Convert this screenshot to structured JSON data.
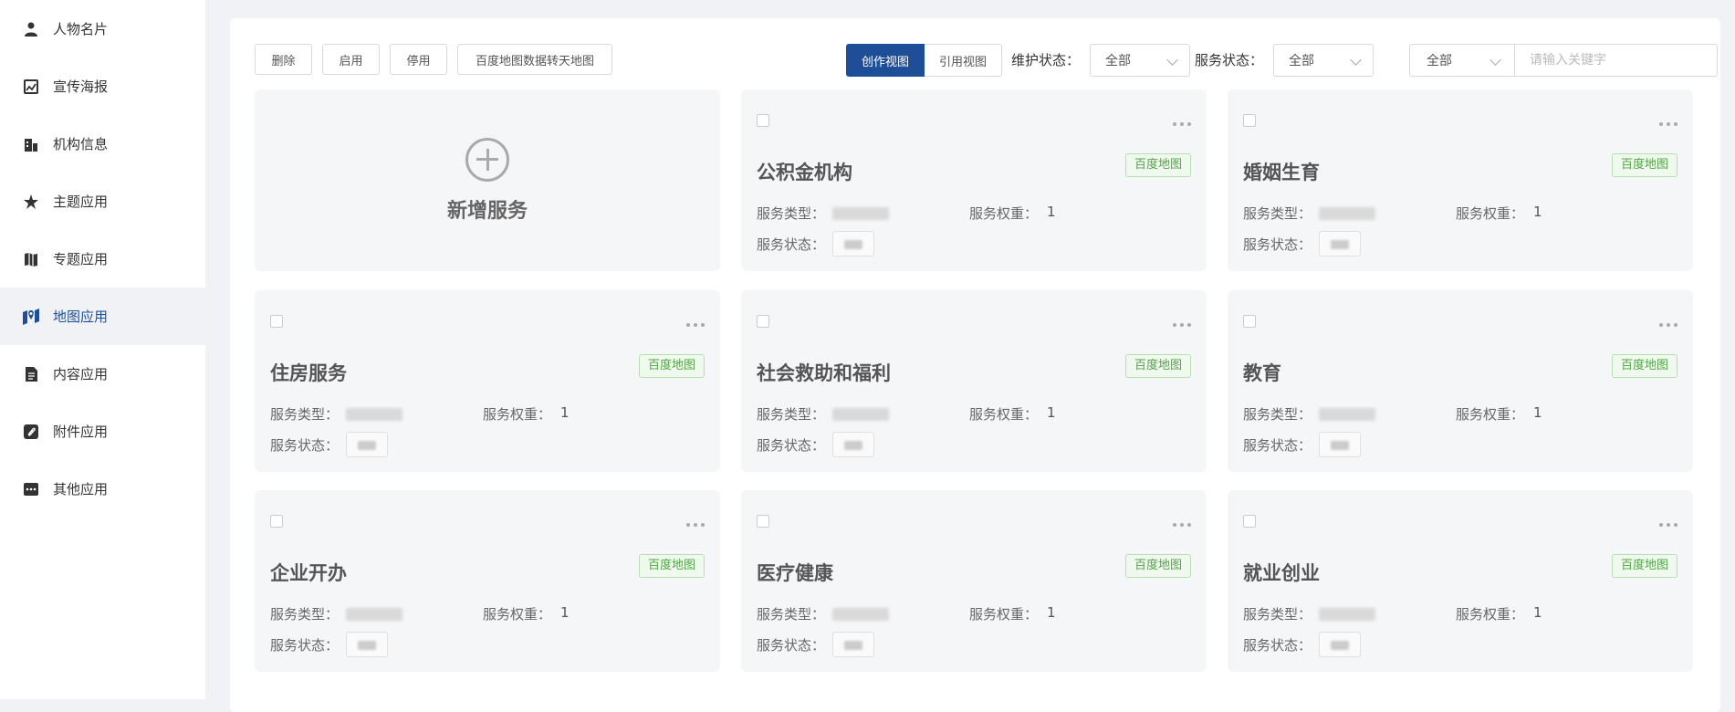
{
  "sidebar": {
    "items": [
      {
        "label": "人物名片",
        "icon": "person-icon"
      },
      {
        "label": "宣传海报",
        "icon": "poster-icon"
      },
      {
        "label": "机构信息",
        "icon": "building-icon"
      },
      {
        "label": "主题应用",
        "icon": "star-icon"
      },
      {
        "label": "专题应用",
        "icon": "map-book-icon"
      },
      {
        "label": "地图应用",
        "icon": "map-pin-icon",
        "active": true
      },
      {
        "label": "内容应用",
        "icon": "document-icon"
      },
      {
        "label": "附件应用",
        "icon": "paperclip-icon"
      },
      {
        "label": "其他应用",
        "icon": "more-icon"
      }
    ]
  },
  "toolbar": {
    "delete_label": "删除",
    "enable_label": "启用",
    "disable_label": "停用",
    "convert_label": "百度地图数据转天地图",
    "view_create": "创作视图",
    "view_reference": "引用视图",
    "maintain_label": "维护状态：",
    "maintain_value": "全部",
    "service_status_label": "服务状态：",
    "service_status_value": "全部",
    "search_scope": "全部",
    "search_placeholder": "请输入关键字"
  },
  "add_card": {
    "label": "新增服务"
  },
  "card_labels": {
    "type": "服务类型：",
    "weight": "服务权重：",
    "status": "服务状态："
  },
  "cards": [
    {
      "title": "公积金机构",
      "tag": "百度地图",
      "weight": "1"
    },
    {
      "title": "婚姻生育",
      "tag": "百度地图",
      "weight": "1"
    },
    {
      "title": "住房服务",
      "tag": "百度地图",
      "weight": "1"
    },
    {
      "title": "社会救助和福利",
      "tag": "百度地图",
      "weight": "1"
    },
    {
      "title": "教育",
      "tag": "百度地图",
      "weight": "1"
    },
    {
      "title": "企业开办",
      "tag": "百度地图",
      "weight": "1"
    },
    {
      "title": "医疗健康",
      "tag": "百度地图",
      "weight": "1"
    },
    {
      "title": "就业创业",
      "tag": "百度地图",
      "weight": "1"
    }
  ],
  "colors": {
    "accent": "#1f4e99",
    "tag_green": "#52a447"
  }
}
